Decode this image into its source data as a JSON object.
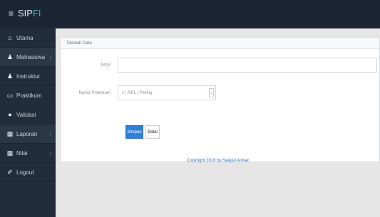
{
  "header": {
    "menu_glyph": "≡",
    "title_prefix": "SIP",
    "title_suffix": "FI"
  },
  "sidebar": {
    "items": [
      {
        "label": "Utama",
        "icon": "home-icon",
        "glyph": "⌂",
        "chevron": ""
      },
      {
        "label": "Mahasiswa",
        "icon": "users-icon",
        "glyph": "👥",
        "chevron": "›"
      },
      {
        "label": "Instruktur",
        "icon": "user-icon",
        "glyph": "♟",
        "chevron": ""
      },
      {
        "label": "Praktikum",
        "icon": "monitor-icon",
        "glyph": "▭",
        "chevron": ""
      },
      {
        "label": "Validasi",
        "icon": "check-circle-icon",
        "glyph": "●",
        "chevron": ""
      },
      {
        "label": "Laporan",
        "icon": "report-icon",
        "glyph": "▦",
        "chevron": "›"
      },
      {
        "label": "Nilai",
        "icon": "grades-icon",
        "glyph": "▦",
        "chevron": "›"
      },
      {
        "label": "Logout",
        "icon": "logout-icon",
        "glyph": "✐",
        "chevron": ""
      }
    ]
  },
  "panel": {
    "title": "Tambah Data",
    "npm_label": "NPM",
    "npm_value": "",
    "praktikum_label": "Nama Praktikum",
    "praktikum_selected": "1 | RPL | Pelling"
  },
  "actions": {
    "save_label": "Simpan",
    "reset_label": "Batal"
  },
  "footer": {
    "text": "Copyright 2018 by Saepul Anwar"
  },
  "colors": {
    "topbar": "#1b2533",
    "sidebar": "#222d3b",
    "primary": "#2f7fd8",
    "accent": "#3fb3c8"
  }
}
